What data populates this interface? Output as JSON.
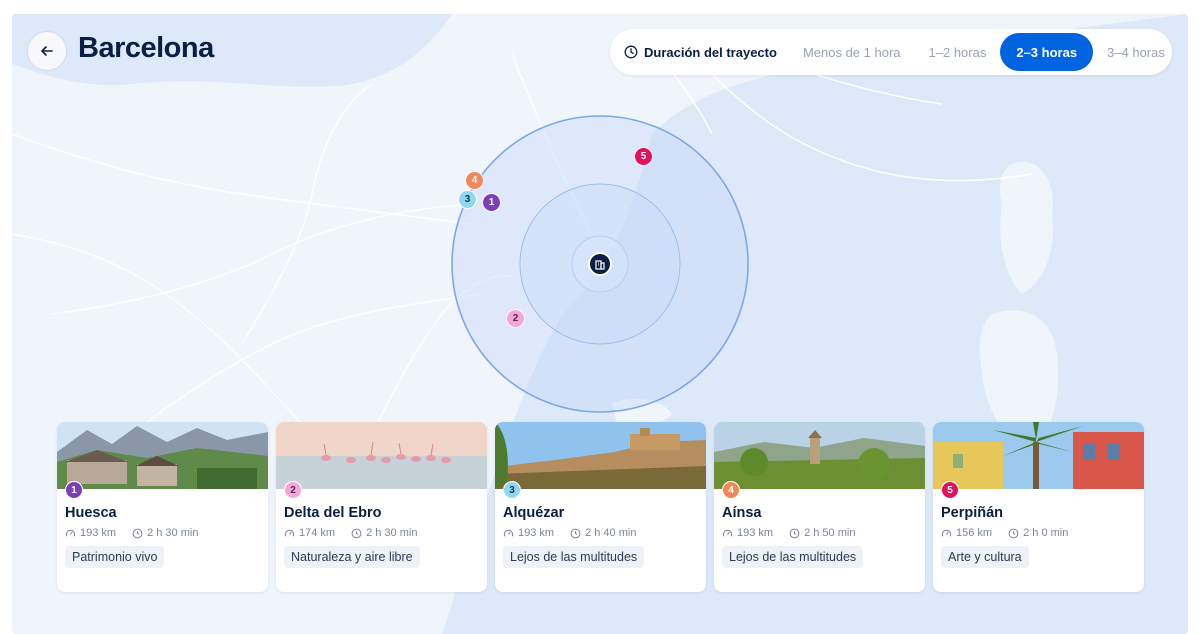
{
  "header": {
    "title": "Barcelona",
    "back_icon": "arrow-left-icon"
  },
  "filter": {
    "label": "Duración del trayecto",
    "label_icon": "clock-icon",
    "options": [
      {
        "label": "Menos de 1 hora",
        "active": false
      },
      {
        "label": "1–2 horas",
        "active": false
      },
      {
        "label": "2–3 horas",
        "active": true
      },
      {
        "label": "3–4 horas",
        "active": false
      }
    ],
    "active_color": "#0064e0"
  },
  "map": {
    "center_icon": "city-building-icon",
    "pins": [
      {
        "num": "1",
        "color": "#7b3fb8"
      },
      {
        "num": "2",
        "color": "#f4a6d8"
      },
      {
        "num": "3",
        "color": "#8fd8f0"
      },
      {
        "num": "4",
        "color": "#f4875a"
      },
      {
        "num": "5",
        "color": "#e0115f"
      }
    ]
  },
  "destinations": [
    {
      "num": "1",
      "name": "Huesca",
      "distance": "193 km",
      "duration": "2 h 30 min",
      "tag": "Patrimonio vivo",
      "color": "#7b3fb8"
    },
    {
      "num": "2",
      "name": "Delta del Ebro",
      "distance": "174 km",
      "duration": "2 h 30 min",
      "tag": "Naturaleza y aire libre",
      "color": "#f4a6d8"
    },
    {
      "num": "3",
      "name": "Alquézar",
      "distance": "193 km",
      "duration": "2 h 40 min",
      "tag": "Lejos de las multitudes",
      "color": "#8fd8f0"
    },
    {
      "num": "4",
      "name": "Aínsa",
      "distance": "193 km",
      "duration": "2 h 50 min",
      "tag": "Lejos de las multitudes",
      "color": "#f4875a"
    },
    {
      "num": "5",
      "name": "Perpiñán",
      "distance": "156 km",
      "duration": "2 h 0 min",
      "tag": "Arte y cultura",
      "color": "#e0115f"
    }
  ]
}
